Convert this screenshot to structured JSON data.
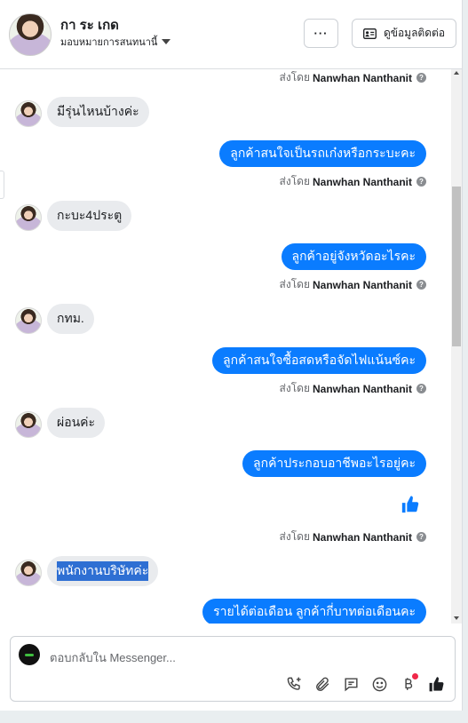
{
  "header": {
    "contact_name": "กา ระ เกด",
    "assign_label": "มอบหมายการสนทนานี้",
    "more_label": "···",
    "contact_info_label": "ดูข้อมูลติดต่อ"
  },
  "sent_by": {
    "prefix": "ส่งโดย",
    "name": "Nanwhan Nanthanit",
    "help_icon": "?"
  },
  "messages": [
    {
      "direction": "in",
      "text": "มีรุ่นไหนบ้างค่ะ"
    },
    {
      "direction": "out",
      "text": "ลูกค้าสนใจเป็นรถเก๋งหรือกระบะคะ"
    },
    {
      "direction": "in",
      "text": "กะบะ4ประตู"
    },
    {
      "direction": "out",
      "text": "ลูกค้าอยู่จังหวัดอะไรคะ"
    },
    {
      "direction": "in",
      "text": "กทม."
    },
    {
      "direction": "out",
      "text": "ลูกค้าสนใจซื้อสดหรือจัดไฟแน้นซ์คะ"
    },
    {
      "direction": "in",
      "text": "ผ่อนค่ะ"
    },
    {
      "direction": "out",
      "text": "ลูกค้าประกอบอาชีพอะไรอยู่คะ"
    },
    {
      "direction": "out",
      "text": "thumbs-up"
    },
    {
      "direction": "in",
      "text": "พนักงานบริษัทค่ะ",
      "selected": true
    },
    {
      "direction": "out",
      "text": "รายได้ต่อเดือน ลูกค้ากี่บาทต่อเดือนคะ"
    }
  ],
  "composer": {
    "placeholder": "ตอบกลับใน Messenger...",
    "tools": [
      "call-add-icon",
      "attachment-icon",
      "saved-reply-icon",
      "emoji-icon",
      "payment-icon",
      "like-icon"
    ]
  },
  "colors": {
    "accent": "#0a7cff",
    "incoming_bubble": "#e9ebee",
    "notification": "#f02849"
  }
}
